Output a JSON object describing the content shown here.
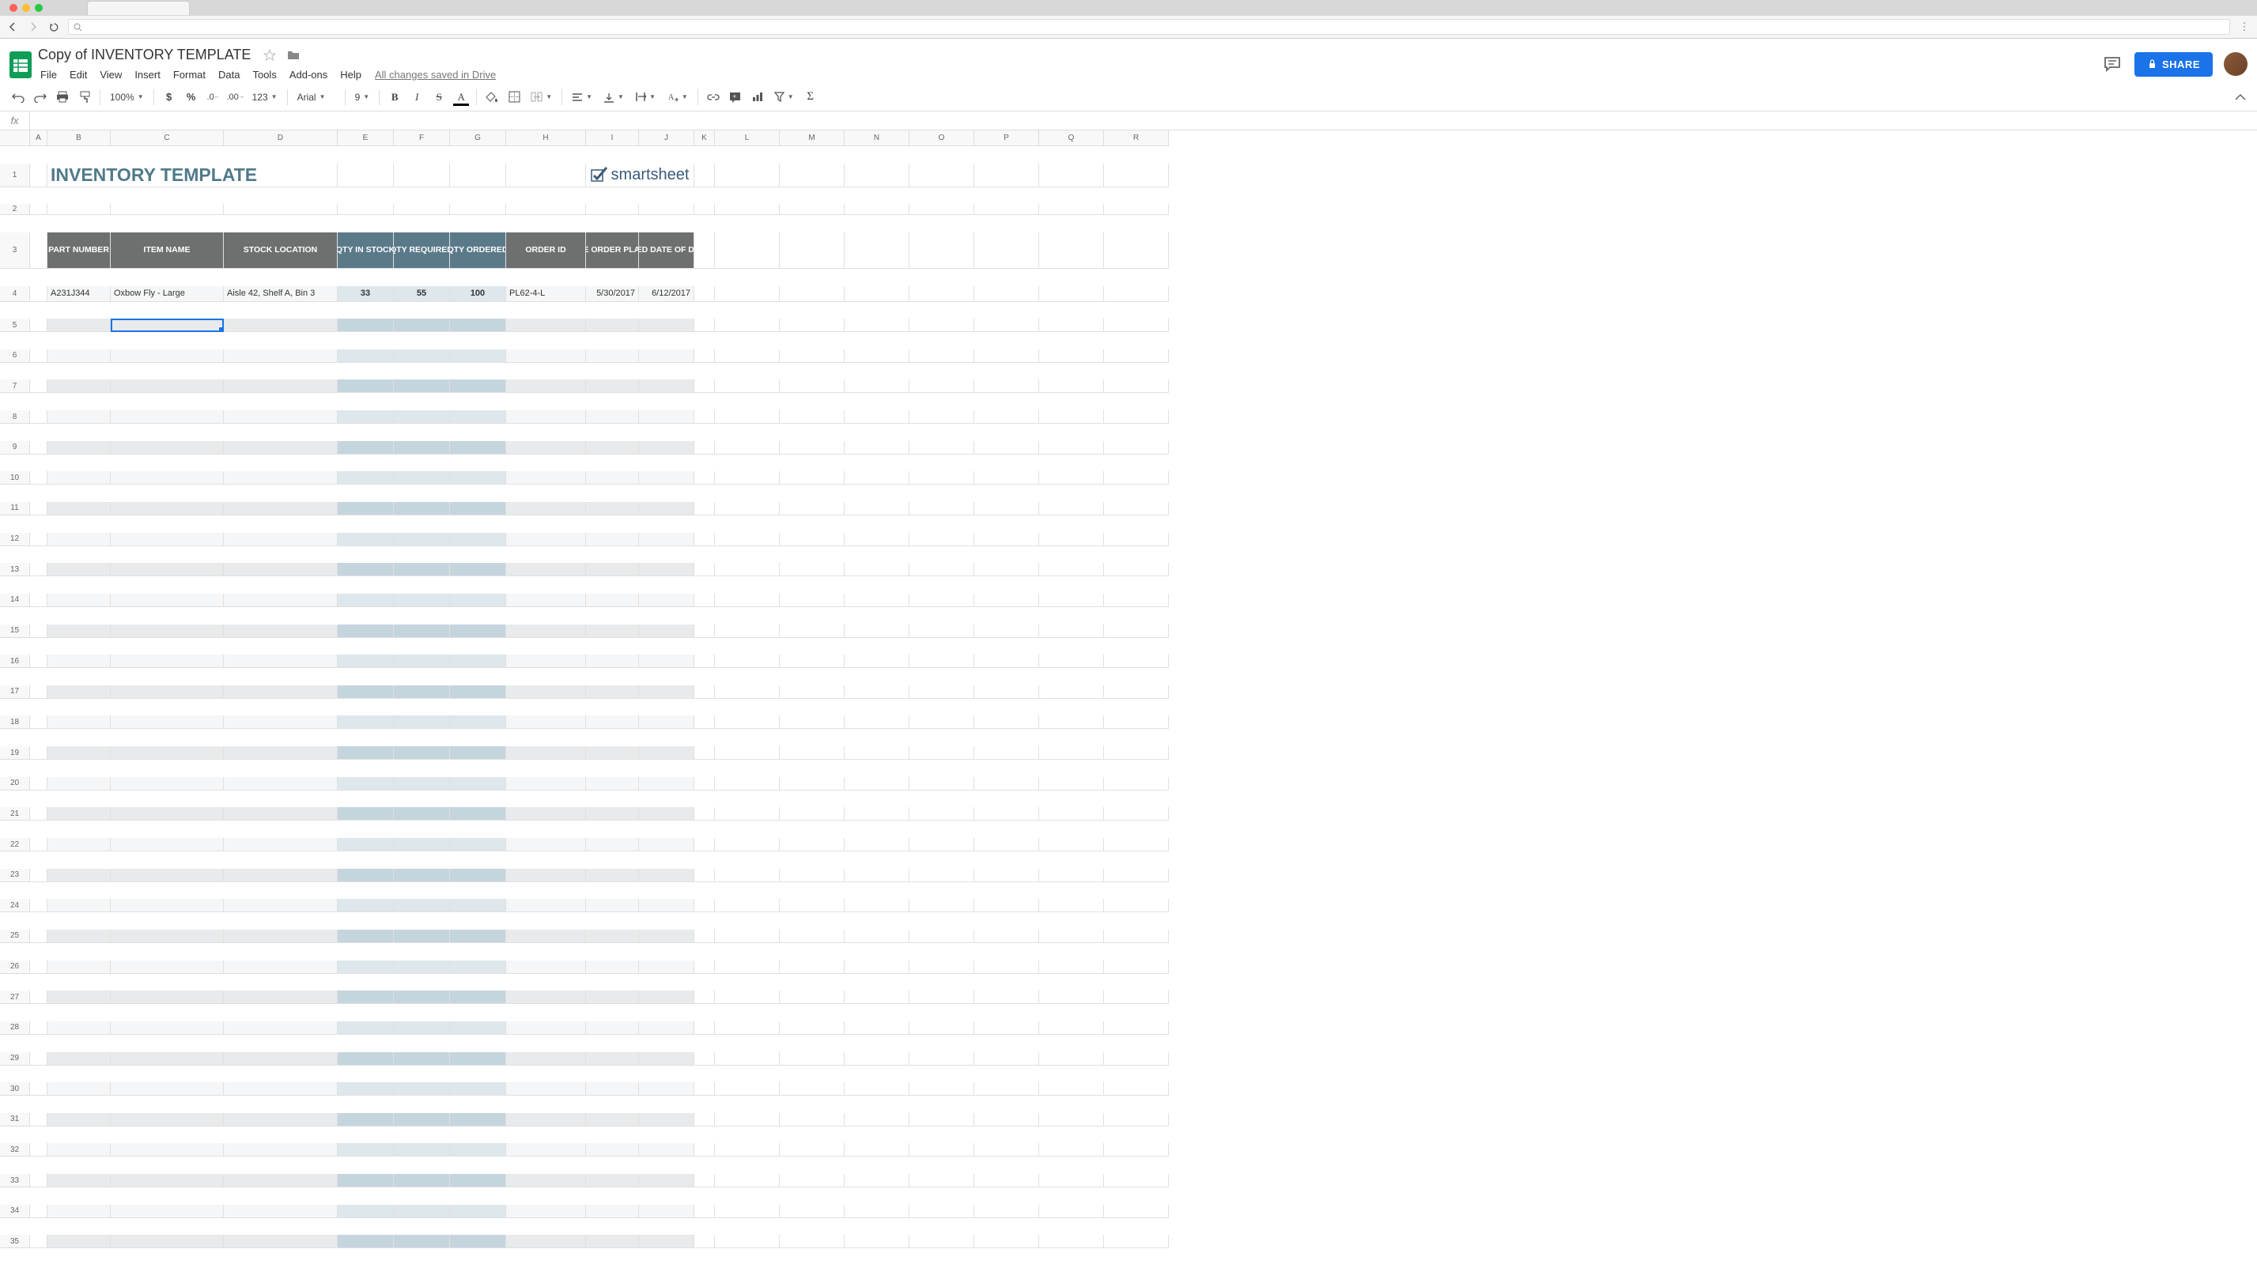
{
  "browser": {
    "url": ""
  },
  "doc": {
    "title": "Copy of INVENTORY TEMPLATE",
    "save_status": "All changes saved in Drive"
  },
  "menubar": [
    "File",
    "Edit",
    "View",
    "Insert",
    "Format",
    "Data",
    "Tools",
    "Add-ons",
    "Help"
  ],
  "toolbar": {
    "zoom": "100%",
    "font": "Arial",
    "size": "9"
  },
  "share_label": "SHARE",
  "columns": [
    "A",
    "B",
    "C",
    "D",
    "E",
    "F",
    "G",
    "H",
    "I",
    "J",
    "K",
    "L",
    "M",
    "N",
    "O",
    "P",
    "Q",
    "R"
  ],
  "col_widths": {
    "A": 22,
    "B": 80,
    "C": 143,
    "D": 144,
    "E": 71,
    "F": 71,
    "G": 71,
    "H": 101,
    "I": 67,
    "J": 70,
    "K": 26,
    "L": 82,
    "M": 82,
    "N": 82,
    "O": 82,
    "P": 82,
    "Q": 82,
    "R": 82
  },
  "row_count_extra": 31,
  "template": {
    "title": "INVENTORY TEMPLATE",
    "brand": "smartsheet",
    "headers": {
      "part_number": "PART NUMBER",
      "item_name": "ITEM NAME",
      "stock_location": "STOCK LOCATION",
      "qty_in_stock": "QTY IN STOCK",
      "qty_required": "QTY REQUIRED",
      "qty_ordered": "QTY ORDERED",
      "order_id": "ORDER ID",
      "date_order_placed": "DATE ORDER PLACED",
      "expected_date": "EXPECTED DATE OF DELIVERY"
    },
    "rows": [
      {
        "part_number": "A231J344",
        "item_name": "Oxbow Fly - Large",
        "stock_location": "Aisle 42, Shelf A, Bin 3",
        "qty_in_stock": "33",
        "qty_required": "55",
        "qty_ordered": "100",
        "order_id": "PL62-4-L",
        "date_order_placed": "5/30/2017",
        "expected_date": "6/12/2017"
      }
    ]
  },
  "selected_cell": "C5"
}
